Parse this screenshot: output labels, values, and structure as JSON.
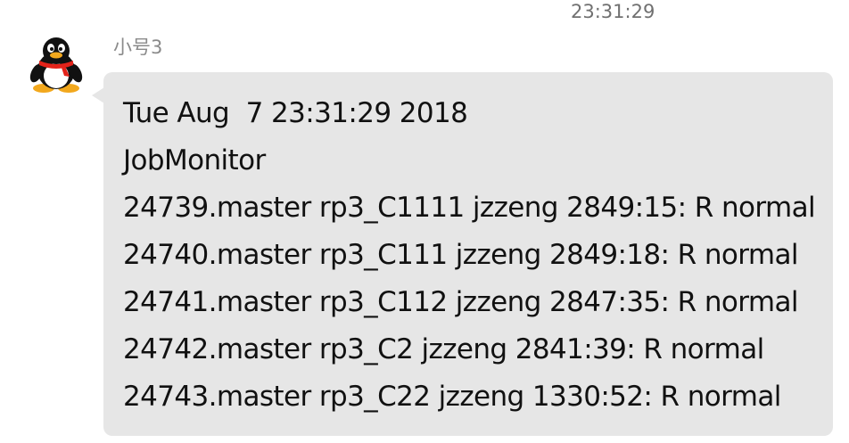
{
  "header": {
    "timestamp": "23:31:29"
  },
  "message": {
    "sender": "小号3",
    "avatar_icon": "penguin-avatar-icon",
    "bubble_color": "#e6e6e6",
    "lines": [
      "Tue Aug  7 23:31:29 2018",
      "JobMonitor",
      "24739.master rp3_C1111 jzzeng 2849:15: R normal",
      "24740.master rp3_C111 jzzeng 2849:18: R normal",
      "24741.master rp3_C112 jzzeng 2847:35: R normal",
      "24742.master rp3_C2 jzzeng 2841:39: R normal",
      "24743.master rp3_C22 jzzeng 1330:52: R normal"
    ]
  }
}
